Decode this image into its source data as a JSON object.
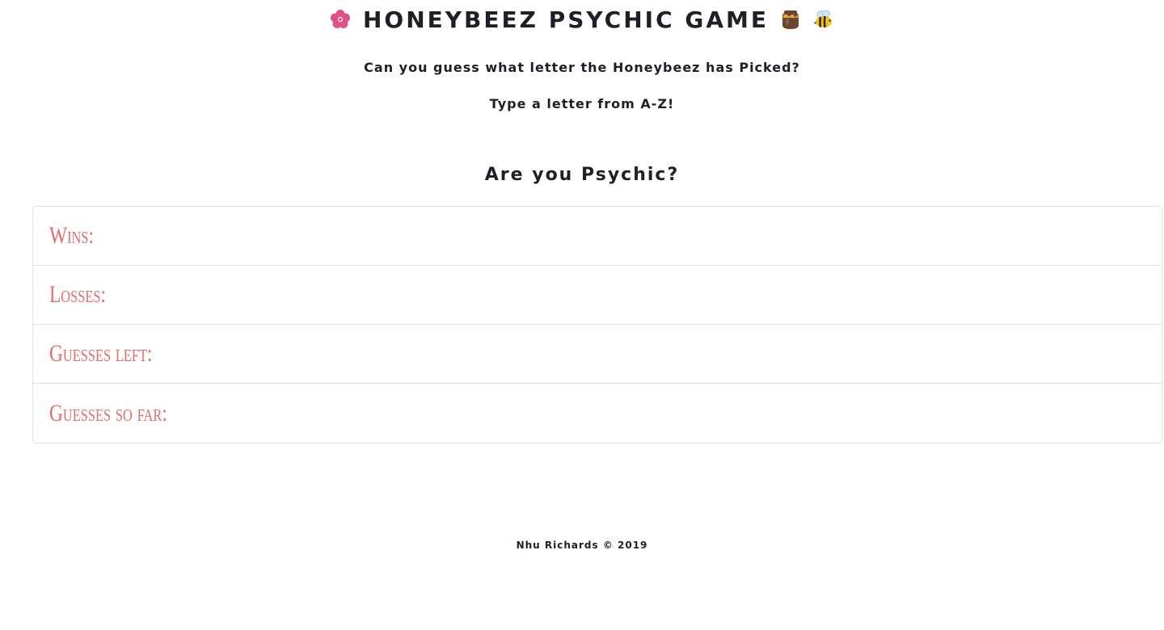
{
  "header": {
    "title": "HONEYBEEZ PSYCHIC GAME",
    "icons": [
      "flower-icon",
      "honey-pot-icon",
      "bee-icon"
    ]
  },
  "intro": {
    "line1": "Can you guess what letter the Honeybeez has Picked?",
    "line2": "Type a letter from A-Z!"
  },
  "question": "Are you Psychic?",
  "stats": [
    {
      "label": "Wins:",
      "value": ""
    },
    {
      "label": "Losses:",
      "value": ""
    },
    {
      "label": "Guesses left:",
      "value": ""
    },
    {
      "label": "Guesses so far:",
      "value": ""
    }
  ],
  "footer": "Nhu Richards © 2019",
  "colors": {
    "accent": "#e46b6b",
    "text": "#1f1f28",
    "border": "#e2e2e2",
    "flower": "#e0508a",
    "honey": "#e7a53a",
    "pot": "#6a4630"
  }
}
